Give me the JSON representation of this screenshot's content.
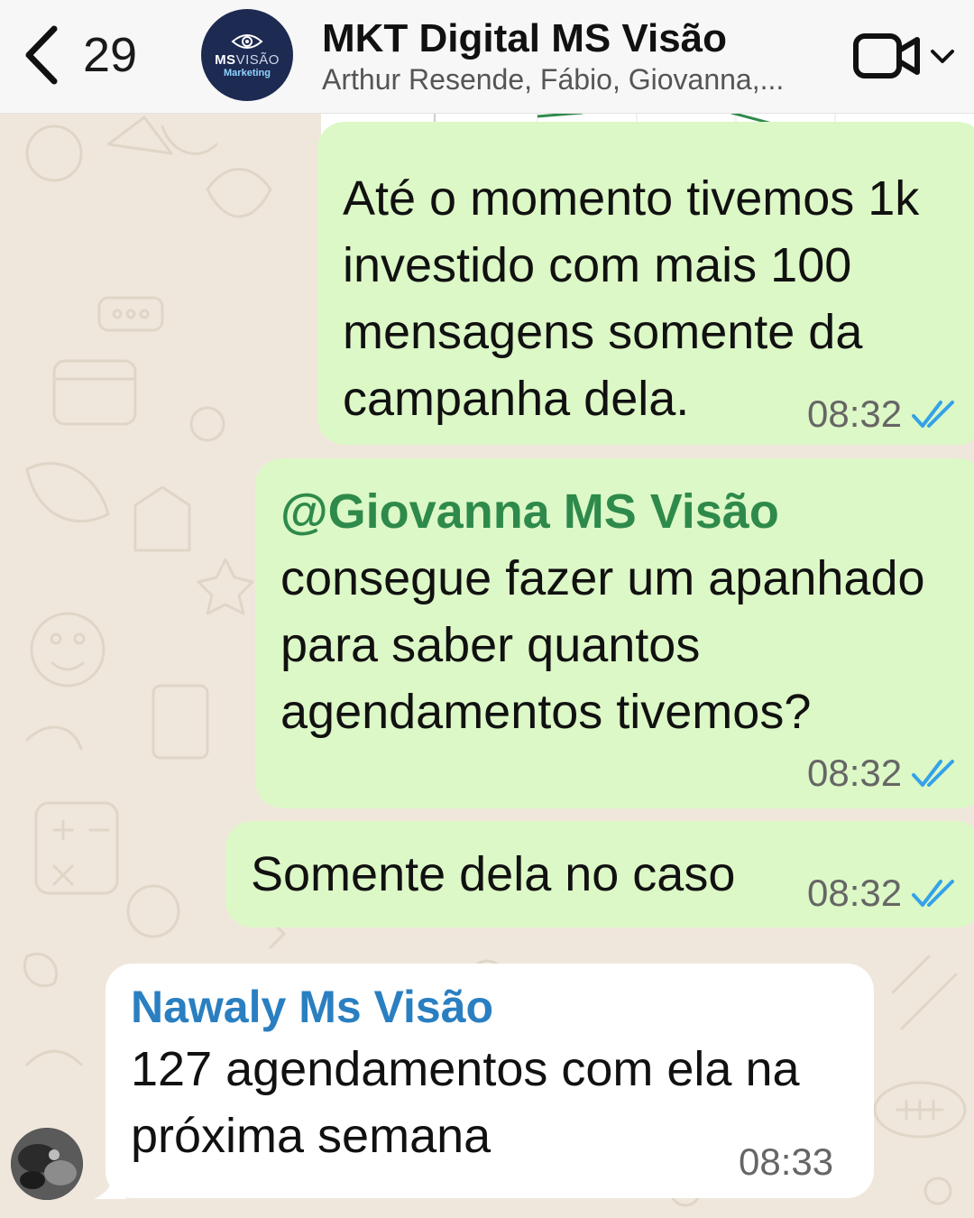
{
  "header": {
    "back_count": "29",
    "avatar_brand_bold": "MS",
    "avatar_brand_light": "VISÃO",
    "avatar_sub": "Marketing",
    "title": "MKT Digital MS Visão",
    "subtitle": "Arthur Resende, Fábio, Giovanna,..."
  },
  "icons": {
    "back": "chevron-left-icon",
    "video": "video-camera-icon",
    "dropdown": "chevron-down-icon",
    "read_receipt": "double-check-icon"
  },
  "colors": {
    "outgoing_bubble": "#dcf8c6",
    "incoming_bubble": "#ffffff",
    "mention": "#2e8a4b",
    "sender_name": "#2a7fc1",
    "read_ticks": "#34a2e8",
    "wallpaper": "#efe7dc"
  },
  "messages": [
    {
      "direction": "outgoing",
      "lines": [
        "Até o momento tivemos 1k",
        "investido com mais 100",
        "mensagens somente da",
        "campanha dela."
      ],
      "time": "08:32",
      "status": "read"
    },
    {
      "direction": "outgoing",
      "mention": "@Giovanna MS Visão",
      "lines": [
        "consegue fazer um apanhado",
        "para saber quantos",
        "agendamentos tivemos?"
      ],
      "time": "08:32",
      "status": "read"
    },
    {
      "direction": "outgoing",
      "lines": [
        "Somente dela no caso"
      ],
      "time": "08:32",
      "status": "read"
    },
    {
      "direction": "incoming",
      "sender": "Nawaly Ms Visão",
      "lines": [
        "127 agendamentos com ela na",
        "próxima semana"
      ],
      "time": "08:33"
    }
  ]
}
